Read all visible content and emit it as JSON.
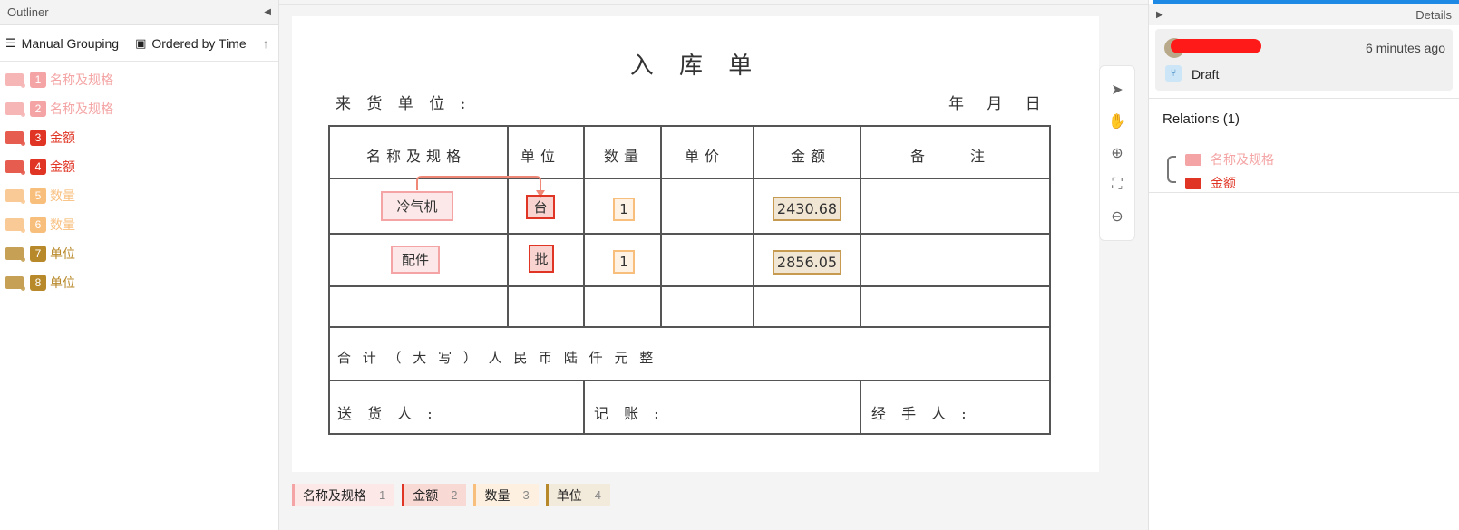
{
  "outliner": {
    "title": "Outliner",
    "grouping_label": "Manual Grouping",
    "ordering_label": "Ordered by Time",
    "annotations": [
      {
        "num": "1",
        "label": "名称及规格",
        "color": "#f4a4a4"
      },
      {
        "num": "2",
        "label": "名称及规格",
        "color": "#f4a4a4"
      },
      {
        "num": "3",
        "label": "金额",
        "color": "#e03524"
      },
      {
        "num": "4",
        "label": "金额",
        "color": "#e03524"
      },
      {
        "num": "5",
        "label": "数量",
        "color": "#f8be7c"
      },
      {
        "num": "6",
        "label": "数量",
        "color": "#f8be7c"
      },
      {
        "num": "7",
        "label": "单位",
        "color": "#b8892a"
      },
      {
        "num": "8",
        "label": "单位",
        "color": "#b8892a"
      }
    ]
  },
  "document": {
    "title": "入 库 单",
    "from_label": "来 货 单 位 :",
    "date_label": "年 月 日",
    "headers": [
      "名称及规格",
      "单位",
      "数量",
      "单价",
      "金额",
      "备　　注"
    ],
    "rows": [
      {
        "name": "冷气机",
        "unit": "台",
        "qty": "1",
        "amount": "2430.68"
      },
      {
        "name": "配件",
        "unit": "批",
        "qty": "1",
        "amount": "2856.05"
      }
    ],
    "total_label": "合 计 （ 大 写 ） 人 民 币 陆 仟 元 整",
    "deliverer_label": "送 货 人 :",
    "bookkeeper_label": "记 账 :",
    "handler_label": "经 手 人 :"
  },
  "legend": [
    {
      "label": "名称及规格",
      "count": "1",
      "color": "#f4a4a4",
      "bg": "#fde8e8"
    },
    {
      "label": "金额",
      "count": "2",
      "color": "#e03524",
      "bg": "#f9d9d4"
    },
    {
      "label": "数量",
      "count": "3",
      "color": "#f8be7c",
      "bg": "#fdf0e0"
    },
    {
      "label": "单位",
      "count": "4",
      "color": "#b8892a",
      "bg": "#f2eadb"
    }
  ],
  "details": {
    "title": "Details",
    "time": "6 minutes ago",
    "status": "Draft",
    "relations_title": "Relations (1)",
    "relations": [
      {
        "label": "名称及规格",
        "color": "#f4a4a4"
      },
      {
        "label": "金额",
        "color": "#e03524"
      }
    ]
  }
}
